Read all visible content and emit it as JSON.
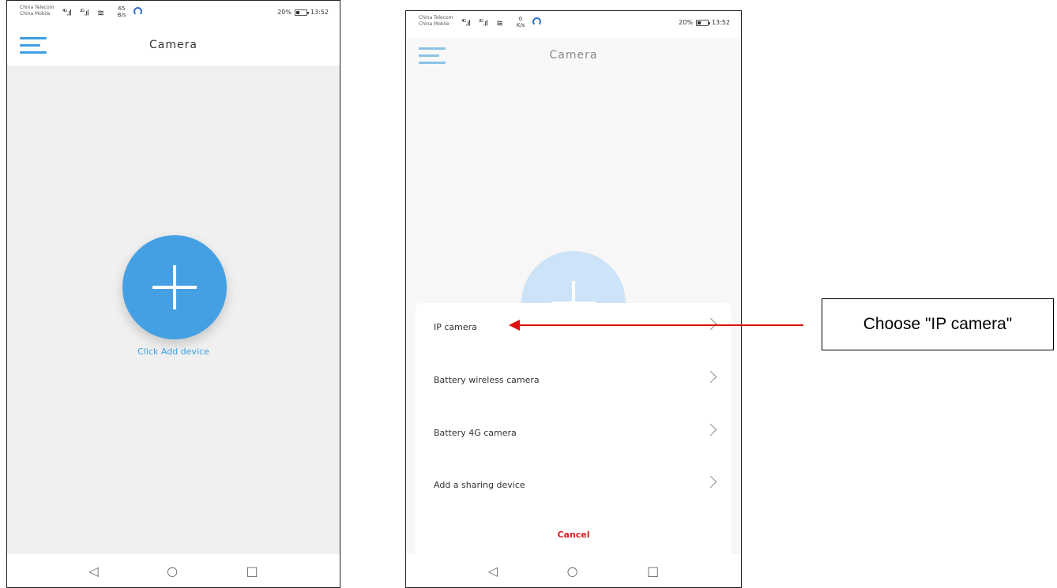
{
  "left_phone": {
    "status_bar": {
      "carrier_1": "China Telecom",
      "carrier_2": "China Mobile",
      "signal_1": "4G",
      "signal_2": "2G",
      "net_speed_value": "65",
      "net_speed_unit": "B/s",
      "battery_percent": "20%",
      "time": "13:52"
    },
    "header": {
      "title": "Camera"
    },
    "main": {
      "add_caption": "Click Add device"
    },
    "nav": {
      "back": "◁",
      "home": "○",
      "recents": "□"
    }
  },
  "right_phone": {
    "status_bar": {
      "carrier_1": "China Telecom",
      "carrier_2": "China Mobile",
      "signal_1": "4G",
      "signal_2": "2G",
      "net_speed_value": "0",
      "net_speed_unit": "K/s",
      "battery_percent": "20%",
      "time": "13:52"
    },
    "header": {
      "title": "Camera"
    },
    "sheet": {
      "items": [
        {
          "label": "IP camera"
        },
        {
          "label": "Battery wireless camera"
        },
        {
          "label": "Battery 4G camera"
        },
        {
          "label": "Add a sharing device"
        }
      ],
      "cancel": "Cancel"
    },
    "nav": {
      "back": "◁",
      "home": "○",
      "recents": "□"
    }
  },
  "callout": {
    "text": "Choose \"IP camera\""
  },
  "colors": {
    "accent": "#45a0e3",
    "accent_faded": "#a4cdf0",
    "cancel": "#d42020",
    "arrow": "#e01010"
  },
  "icons": [
    "menu-icon",
    "plus-icon",
    "wifi-icon",
    "battery-icon",
    "chevron-right-icon",
    "back-icon",
    "home-icon",
    "recents-icon"
  ]
}
